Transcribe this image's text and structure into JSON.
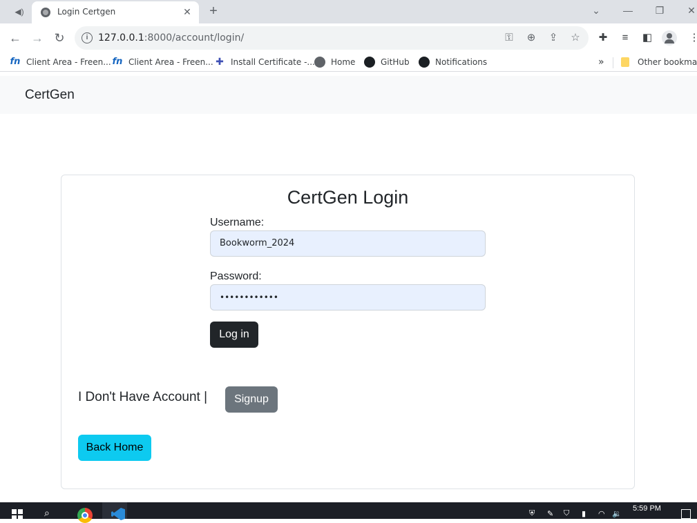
{
  "browser": {
    "tab_title": "Login Certgen",
    "url_host": "127.0.0.1",
    "url_path": ":8000/account/login/",
    "bookmarks": [
      {
        "label": "Client Area - Freen...",
        "icon": "freenom-icon"
      },
      {
        "label": "Client Area - Freen...",
        "icon": "freenom-icon"
      },
      {
        "label": "Install Certificate -...",
        "icon": "puzzle-icon"
      },
      {
        "label": "Home",
        "icon": "globe-icon"
      },
      {
        "label": "GitHub",
        "icon": "github-icon"
      },
      {
        "label": "Notifications",
        "icon": "github-icon"
      }
    ],
    "other_bookmarks": "Other bookmarks",
    "more_bookmarks_glyph": "»"
  },
  "navbar": {
    "brand": "CertGen"
  },
  "login": {
    "title": "CertGen Login",
    "username_label": "Username:",
    "username_value": "Bookworm_2024",
    "password_label": "Password:",
    "password_value": "••••••••••••",
    "login_button": "Log in",
    "no_account_text": "I Don't Have Account |",
    "signup_button": "Signup",
    "back_home_button": "Back Home"
  },
  "taskbar": {
    "time": "5:59 PM"
  },
  "colors": {
    "login_button": "#212529",
    "signup_button": "#6c757d",
    "back_home_button": "#0dcaf0",
    "input_autofill": "#e8f0fe",
    "navbar_bg": "#f8f9fa"
  }
}
